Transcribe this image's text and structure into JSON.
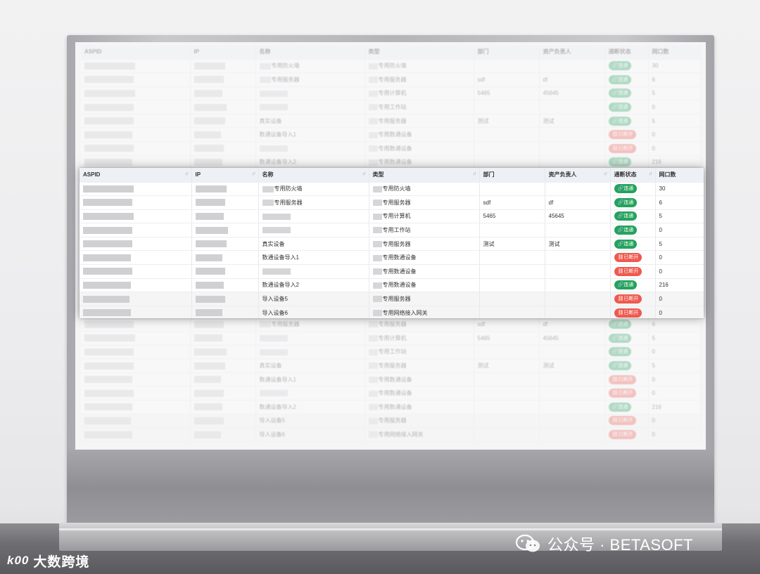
{
  "table": {
    "columns": [
      "ASPID",
      "IP",
      "名称",
      "类型",
      "部门",
      "资产负责人",
      "通断状态",
      "网口数"
    ],
    "rows": [
      {
        "name": "专用防火墙",
        "name_ph": true,
        "type": "专用防火墙",
        "dept": "",
        "owner": "",
        "status": "连通",
        "ok": true,
        "ports": "30"
      },
      {
        "name": "专用服务器",
        "name_ph": true,
        "type": "专用服务器",
        "dept": "sdf",
        "owner": "df",
        "status": "连通",
        "ok": true,
        "ports": "6"
      },
      {
        "name": "",
        "name_ph": true,
        "type": "专用计算机",
        "dept": "5465",
        "owner": "45645",
        "status": "连通",
        "ok": true,
        "ports": "5"
      },
      {
        "name": "",
        "name_ph": true,
        "type": "专用工作站",
        "dept": "",
        "owner": "",
        "status": "连通",
        "ok": true,
        "ports": "0"
      },
      {
        "name": "真实设备",
        "name_ph": false,
        "type": "专用服务器",
        "dept": "测试",
        "owner": "测试",
        "status": "连通",
        "ok": true,
        "ports": "5"
      },
      {
        "name": "数通设备导入1",
        "name_ph": false,
        "type": "专用数通设备",
        "dept": "",
        "owner": "",
        "status": "已断开",
        "ok": false,
        "ports": "0"
      },
      {
        "name": "",
        "name_ph": true,
        "type": "专用数通设备",
        "dept": "",
        "owner": "",
        "status": "已断开",
        "ok": false,
        "ports": "0"
      },
      {
        "name": "数通设备导入2",
        "name_ph": false,
        "type": "专用数通设备",
        "dept": "",
        "owner": "",
        "status": "连通",
        "ok": true,
        "ports": "216"
      },
      {
        "name": "导入设备5",
        "name_ph": false,
        "type": "专用服务器",
        "dept": "",
        "owner": "",
        "status": "已断开",
        "ok": false,
        "ports": "0"
      },
      {
        "name": "导入设备6",
        "name_ph": false,
        "type": "专用网络接入网关",
        "dept": "",
        "owner": "",
        "status": "已断开",
        "ok": false,
        "ports": "0"
      }
    ]
  },
  "watermark": {
    "left_logo": "k00",
    "left_text": "大数跨境",
    "right_text": "公众号 · BETASOFT"
  },
  "colors": {
    "ok": "#23a35a",
    "bad": "#ee5a4f",
    "header_bg": "#edf0f5"
  }
}
